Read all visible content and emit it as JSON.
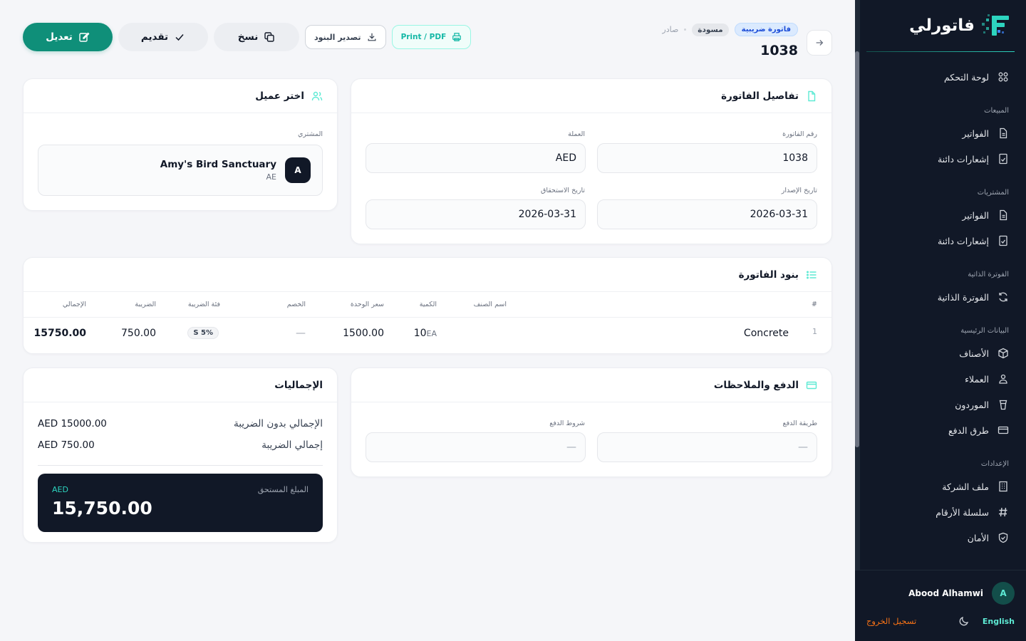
{
  "brand": {
    "name": "فاتورلي",
    "accent": "#2dd4bf"
  },
  "sidebar": {
    "dashboard": "لوحة التحكم",
    "sections": [
      {
        "title": "المبيعات",
        "items": [
          {
            "label": "الفواتير",
            "icon": "file-icon"
          },
          {
            "label": "إشعارات دائنة",
            "icon": "credit-note-icon"
          }
        ]
      },
      {
        "title": "المشتريات",
        "items": [
          {
            "label": "الفواتير",
            "icon": "file-icon"
          },
          {
            "label": "إشعارات دائنة",
            "icon": "credit-note-icon"
          }
        ]
      },
      {
        "title": "الفوترة الذاتية",
        "items": [
          {
            "label": "الفوترة الذاتية",
            "icon": "refresh-icon"
          }
        ]
      },
      {
        "title": "البيانات الرئيسية",
        "items": [
          {
            "label": "الأصناف",
            "icon": "box-icon"
          },
          {
            "label": "العملاء",
            "icon": "users-icon"
          },
          {
            "label": "الموردون",
            "icon": "supplier-icon"
          },
          {
            "label": "طرق الدفع",
            "icon": "card-icon"
          }
        ]
      },
      {
        "title": "الإعدادات",
        "items": [
          {
            "label": "ملف الشركة",
            "icon": "building-icon"
          },
          {
            "label": "سلسلة الأرقام",
            "icon": "hash-icon"
          },
          {
            "label": "الأمان",
            "icon": "shield-icon"
          }
        ]
      }
    ],
    "user": {
      "name": "Abood Alhamwi",
      "initial": "A"
    },
    "language": "English",
    "logout": "تسجيل الخروج"
  },
  "header": {
    "badge_tax": "فاتورة ضريبية",
    "badge_draft": "مسودة",
    "status": "صادر",
    "invoice_number": "1038"
  },
  "actions": {
    "edit": "تعديل",
    "submit": "تقديم",
    "copy": "نسخ",
    "export": "تصدير البنود",
    "print": "Print / PDF"
  },
  "invoice_details": {
    "title": "تفاصيل الفاتورة",
    "invoice_no_label": "رقم الفاتورة",
    "invoice_no": "1038",
    "currency_label": "العملة",
    "currency": "AED",
    "issue_date_label": "تاريخ الإصدار",
    "issue_date": "2026-03-31",
    "due_date_label": "تاريخ الاستحقاق",
    "due_date": "2026-03-31"
  },
  "customer": {
    "title": "اختر عميل",
    "buyer_label": "المشتري",
    "initial": "A",
    "name": "Amy's Bird Sanctuary",
    "country": "AE"
  },
  "items": {
    "title": "بنود الفاتورة",
    "columns": {
      "num": "#",
      "name": "اسم الصنف",
      "qty": "الكمية",
      "unit_price": "سعر الوحدة",
      "discount": "الخصم",
      "tax_cat": "فئة الضريبة",
      "tax": "الضريبة",
      "total": "الإجمالي"
    },
    "rows": [
      {
        "num": "1",
        "name": "Concrete",
        "qty": "10",
        "unit": "EA",
        "unit_price": "1500.00",
        "discount": "—",
        "tax_cat": "S 5%",
        "tax": "750.00",
        "total": "15750.00"
      }
    ]
  },
  "payment": {
    "title": "الدفع والملاحظات",
    "method_label": "طريقة الدفع",
    "method": "—",
    "terms_label": "شروط الدفع",
    "terms": "—"
  },
  "totals": {
    "title": "الإجماليات",
    "subtotal_label": "الإجمالي بدون الضريبة",
    "subtotal": "AED 15000.00",
    "tax_label": "إجمالي الضريبة",
    "tax": "AED 750.00",
    "due_label": "المبلغ المستحق",
    "due_currency": "AED",
    "due_amount": "15,750.00"
  }
}
